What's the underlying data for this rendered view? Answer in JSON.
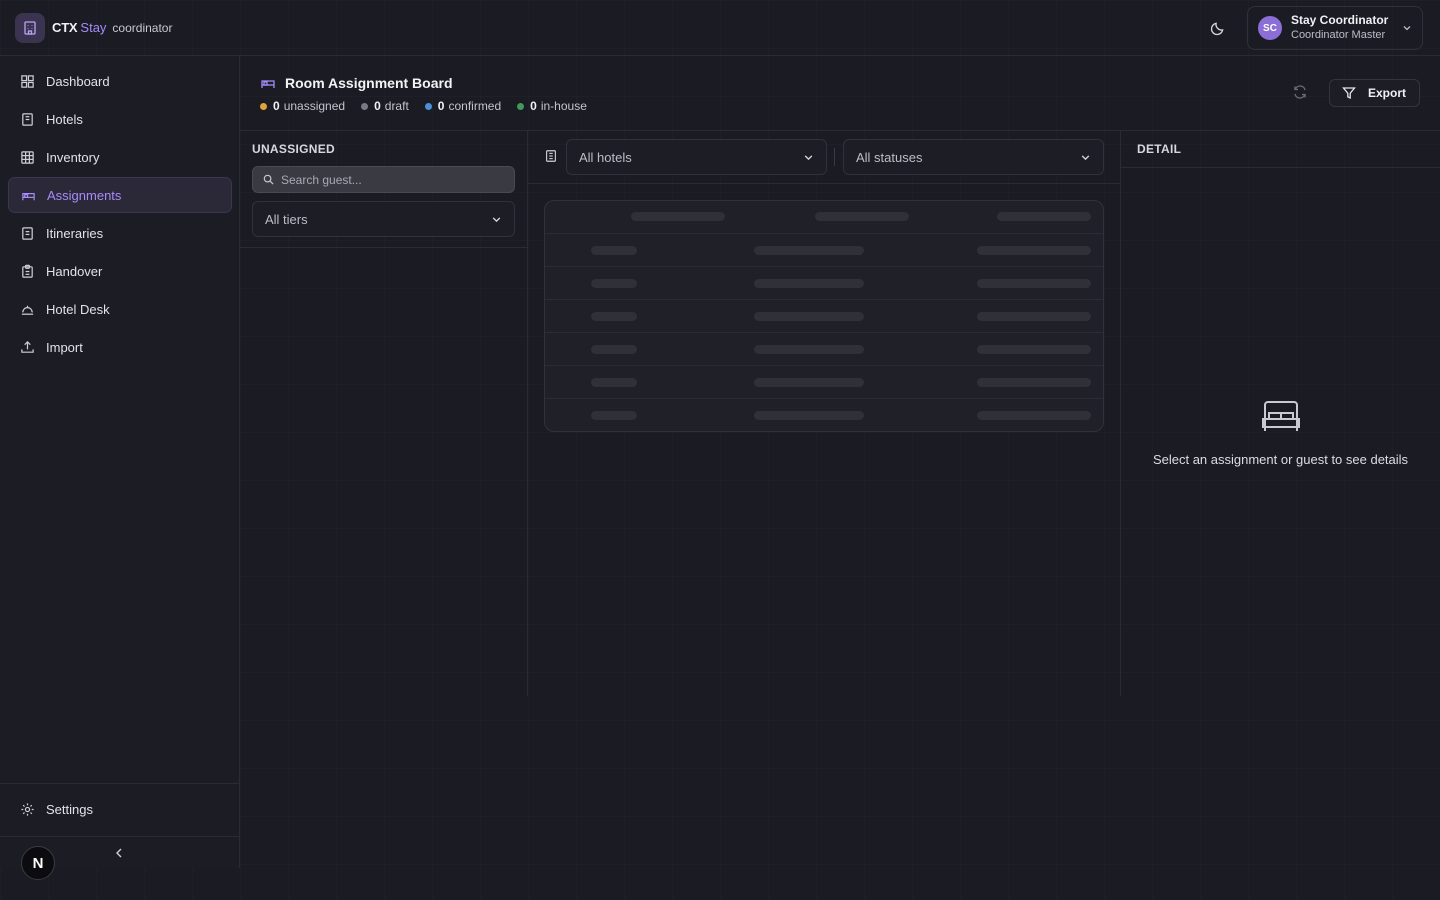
{
  "brand": {
    "name": "CTX",
    "accent": "Stay",
    "role": "coordinator"
  },
  "user": {
    "initials": "SC",
    "name": "Stay Coordinator",
    "role": "Coordinator Master"
  },
  "nav": {
    "items": [
      {
        "label": "Dashboard",
        "icon": "dashboard-icon"
      },
      {
        "label": "Hotels",
        "icon": "building-icon"
      },
      {
        "label": "Inventory",
        "icon": "grid-icon"
      },
      {
        "label": "Assignments",
        "icon": "bed-icon",
        "active": true
      },
      {
        "label": "Itineraries",
        "icon": "document-icon"
      },
      {
        "label": "Handover",
        "icon": "clipboard-icon"
      },
      {
        "label": "Hotel Desk",
        "icon": "bell-icon"
      },
      {
        "label": "Import",
        "icon": "upload-icon"
      }
    ],
    "settings": "Settings",
    "badge": "N"
  },
  "page": {
    "title": "Room Assignment Board",
    "stats": [
      {
        "count": "0",
        "label": "unassigned",
        "color": "#e0a33b"
      },
      {
        "count": "0",
        "label": "draft",
        "color": "#7a7a85"
      },
      {
        "count": "0",
        "label": "confirmed",
        "color": "#4a90d9"
      },
      {
        "count": "0",
        "label": "in-house",
        "color": "#3f9a5c"
      }
    ],
    "export_label": "Export"
  },
  "unassigned": {
    "title": "UNASSIGNED",
    "search_placeholder": "Search guest...",
    "tier_filter": "All tiers"
  },
  "filters": {
    "hotels": "All hotels",
    "statuses": "All statuses"
  },
  "detail": {
    "title": "DETAIL",
    "empty_text": "Select an assignment or guest to see details"
  },
  "colors": {
    "accent": "#a78bfa",
    "background": "#1b1c23"
  }
}
